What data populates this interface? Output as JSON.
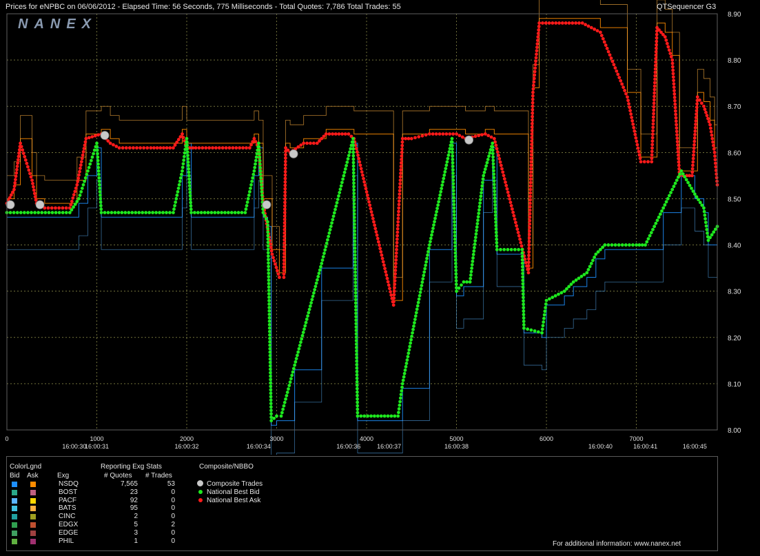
{
  "header": {
    "title": "Prices for  eNPBC  on  06/06/2012  -  Elapsed Time: 56 Seconds, 775 Milliseconds  -  Total Quotes: 7,786  Total Trades: 55",
    "app": "QTSequencer G3",
    "brand": "NANEX"
  },
  "chart_data": {
    "type": "line",
    "ylim": [
      8.0,
      8.9
    ],
    "yticks": [
      "8.00",
      "8.10",
      "8.20",
      "8.30",
      "8.40",
      "8.50",
      "8.60",
      "8.70",
      "8.80",
      "8.90"
    ],
    "xlim": [
      0,
      7900
    ],
    "xticks": [
      {
        "x": 0,
        "label": "0"
      },
      {
        "x": 1000,
        "label": "1000"
      },
      {
        "x": 2000,
        "label": "2000"
      },
      {
        "x": 3000,
        "label": "3000"
      },
      {
        "x": 4000,
        "label": "4000"
      },
      {
        "x": 5000,
        "label": "5000"
      },
      {
        "x": 6000,
        "label": "6000"
      },
      {
        "x": 7000,
        "label": "7000"
      }
    ],
    "time_labels": [
      {
        "x": 750,
        "label": "16:00:30"
      },
      {
        "x": 1000,
        "label": "16:00:31"
      },
      {
        "x": 2000,
        "label": "16:00:32"
      },
      {
        "x": 2800,
        "label": "16:00:34"
      },
      {
        "x": 3800,
        "label": "16:00:36"
      },
      {
        "x": 4250,
        "label": "16:00:37"
      },
      {
        "x": 5000,
        "label": "16:00:38"
      },
      {
        "x": 6600,
        "label": "16:00:40"
      },
      {
        "x": 7100,
        "label": "16:00:41"
      },
      {
        "x": 7650,
        "label": "16:00:45"
      }
    ],
    "grid": true,
    "series": [
      {
        "name": "National Best Ask",
        "color": "#ff1a1a",
        "points": [
          [
            0,
            8.49
          ],
          [
            80,
            8.52
          ],
          [
            150,
            8.62
          ],
          [
            280,
            8.54
          ],
          [
            330,
            8.49
          ],
          [
            420,
            8.48
          ],
          [
            700,
            8.48
          ],
          [
            780,
            8.53
          ],
          [
            880,
            8.63
          ],
          [
            1050,
            8.64
          ],
          [
            1150,
            8.62
          ],
          [
            1250,
            8.61
          ],
          [
            1600,
            8.61
          ],
          [
            1850,
            8.61
          ],
          [
            1950,
            8.64
          ],
          [
            2000,
            8.61
          ],
          [
            2100,
            8.61
          ],
          [
            2700,
            8.61
          ],
          [
            2750,
            8.63
          ],
          [
            2800,
            8.61
          ],
          [
            2850,
            8.49
          ],
          [
            2950,
            8.38
          ],
          [
            3030,
            8.33
          ],
          [
            3080,
            8.33
          ],
          [
            3100,
            8.61
          ],
          [
            3150,
            8.6
          ],
          [
            3300,
            8.62
          ],
          [
            3450,
            8.62
          ],
          [
            3550,
            8.64
          ],
          [
            3800,
            8.64
          ],
          [
            3860,
            8.63
          ],
          [
            4300,
            8.27
          ],
          [
            4400,
            8.63
          ],
          [
            4500,
            8.63
          ],
          [
            4700,
            8.64
          ],
          [
            5000,
            8.64
          ],
          [
            5100,
            8.63
          ],
          [
            5320,
            8.64
          ],
          [
            5420,
            8.63
          ],
          [
            5800,
            8.34
          ],
          [
            5850,
            8.73
          ],
          [
            5920,
            8.88
          ],
          [
            6400,
            8.88
          ],
          [
            6600,
            8.86
          ],
          [
            6900,
            8.72
          ],
          [
            7050,
            8.58
          ],
          [
            7170,
            8.58
          ],
          [
            7230,
            8.87
          ],
          [
            7320,
            8.85
          ],
          [
            7400,
            8.8
          ],
          [
            7480,
            8.55
          ],
          [
            7520,
            8.55
          ],
          [
            7560,
            8.55
          ],
          [
            7620,
            8.55
          ],
          [
            7680,
            8.72
          ],
          [
            7750,
            8.7
          ],
          [
            7820,
            8.66
          ],
          [
            7870,
            8.6
          ],
          [
            7900,
            8.53
          ]
        ]
      },
      {
        "name": "National Best Bid",
        "color": "#1ee81e",
        "points": [
          [
            0,
            8.47
          ],
          [
            350,
            8.47
          ],
          [
            700,
            8.47
          ],
          [
            800,
            8.5
          ],
          [
            900,
            8.56
          ],
          [
            1000,
            8.62
          ],
          [
            1050,
            8.47
          ],
          [
            1850,
            8.47
          ],
          [
            1950,
            8.56
          ],
          [
            2000,
            8.63
          ],
          [
            2050,
            8.47
          ],
          [
            2650,
            8.47
          ],
          [
            2750,
            8.56
          ],
          [
            2800,
            8.62
          ],
          [
            2850,
            8.47
          ],
          [
            2900,
            8.45
          ],
          [
            2940,
            8.02
          ],
          [
            3000,
            8.03
          ],
          [
            3050,
            8.03
          ],
          [
            3200,
            8.14
          ],
          [
            3500,
            8.36
          ],
          [
            3850,
            8.63
          ],
          [
            3900,
            8.03
          ],
          [
            4350,
            8.03
          ],
          [
            4400,
            8.1
          ],
          [
            4700,
            8.4
          ],
          [
            4950,
            8.63
          ],
          [
            5000,
            8.3
          ],
          [
            5080,
            8.32
          ],
          [
            5150,
            8.32
          ],
          [
            5300,
            8.55
          ],
          [
            5400,
            8.62
          ],
          [
            5450,
            8.39
          ],
          [
            5730,
            8.39
          ],
          [
            5750,
            8.22
          ],
          [
            5950,
            8.21
          ],
          [
            6000,
            8.28
          ],
          [
            6200,
            8.3
          ],
          [
            6300,
            8.32
          ],
          [
            6450,
            8.34
          ],
          [
            6550,
            8.38
          ],
          [
            6650,
            8.4
          ],
          [
            7000,
            8.4
          ],
          [
            7100,
            8.4
          ],
          [
            7300,
            8.48
          ],
          [
            7500,
            8.56
          ],
          [
            7650,
            8.51
          ],
          [
            7750,
            8.48
          ],
          [
            7800,
            8.41
          ],
          [
            7900,
            8.44
          ]
        ]
      }
    ],
    "legend": {
      "color_legend_title": "ColorLgnd",
      "bid_label": "Bid",
      "ask_label": "Ask",
      "exg_stats_title": "Reporting Exg Stats",
      "col_exg": "Exg",
      "col_quotes": "# Quotes",
      "col_trades": "# Trades",
      "exchanges": [
        {
          "name": "NSDQ",
          "quotes": "7,565",
          "trades": "53",
          "bid_color": "#1e90ff",
          "ask_color": "#ff8c00"
        },
        {
          "name": "BOST",
          "quotes": "23",
          "trades": "0",
          "bid_color": "#2aa88a",
          "ask_color": "#c06080"
        },
        {
          "name": "PACF",
          "quotes": "92",
          "trades": "0",
          "bid_color": "#5ab4ff",
          "ask_color": "#ffd700"
        },
        {
          "name": "BATS",
          "quotes": "95",
          "trades": "0",
          "bid_color": "#40c0e0",
          "ask_color": "#ffb040"
        },
        {
          "name": "CINC",
          "quotes": "2",
          "trades": "0",
          "bid_color": "#20a0a0",
          "ask_color": "#a0a020"
        },
        {
          "name": "EDGX",
          "quotes": "5",
          "trades": "2",
          "bid_color": "#30a050",
          "ask_color": "#c05030"
        },
        {
          "name": "EDGE",
          "quotes": "3",
          "trades": "0",
          "bid_color": "#40a060",
          "ask_color": "#a04040"
        },
        {
          "name": "PHIL",
          "quotes": "1",
          "trades": "0",
          "bid_color": "#60b040",
          "ask_color": "#a03070"
        }
      ],
      "composite_title": "Composite/NBBO",
      "composite_items": [
        {
          "label": "Composite Trades",
          "color": "#c8c8c8"
        },
        {
          "label": "National Best Bid",
          "color": "#1ee81e"
        },
        {
          "label": "National Best Ask",
          "color": "#ff1a1a"
        }
      ],
      "footer": "For additional information: www.nanex.net"
    }
  }
}
